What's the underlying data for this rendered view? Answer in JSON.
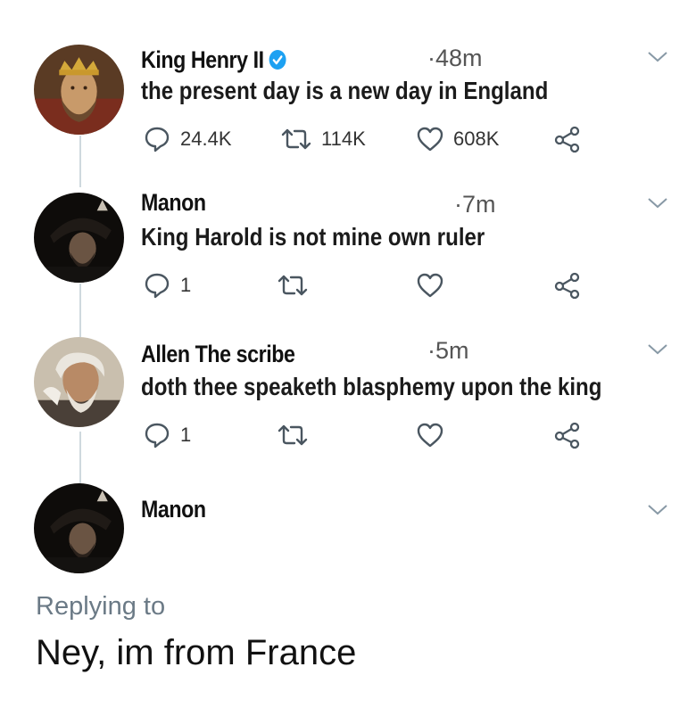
{
  "tweets": [
    {
      "name": "King Henry II",
      "verified": true,
      "time": "48m",
      "text": "the present day is a new day in England",
      "replies": "24.4K",
      "retweets": "114K",
      "likes": "608K",
      "avatar_icon": "crowned-king-portrait-avatar"
    },
    {
      "name": "Manon",
      "verified": false,
      "time": "7m",
      "text": "King Harold is not mine own ruler",
      "replies": "1",
      "retweets": "",
      "likes": "",
      "avatar_icon": "hooded-figure-avatar"
    },
    {
      "name": "Allen The scribe",
      "verified": false,
      "time": "5m",
      "text": "doth thee speaketh blasphemy upon the king",
      "replies": "1",
      "retweets": "",
      "likes": "",
      "avatar_icon": "old-scribe-portrait-avatar"
    },
    {
      "name": "Manon",
      "verified": false,
      "time": "",
      "text": "",
      "avatar_icon": "hooded-figure-avatar"
    }
  ],
  "reply": {
    "label": "Replying to",
    "text": "Ney, im from France"
  },
  "icons": [
    "reply-icon",
    "retweet-icon",
    "like-icon",
    "share-icon",
    "chevron-down-icon",
    "verified-badge-icon"
  ],
  "colors": {
    "verified": "#1da1f2",
    "icon": "#657786",
    "thread": "#cfd9de",
    "meta": "#6b7a86"
  }
}
